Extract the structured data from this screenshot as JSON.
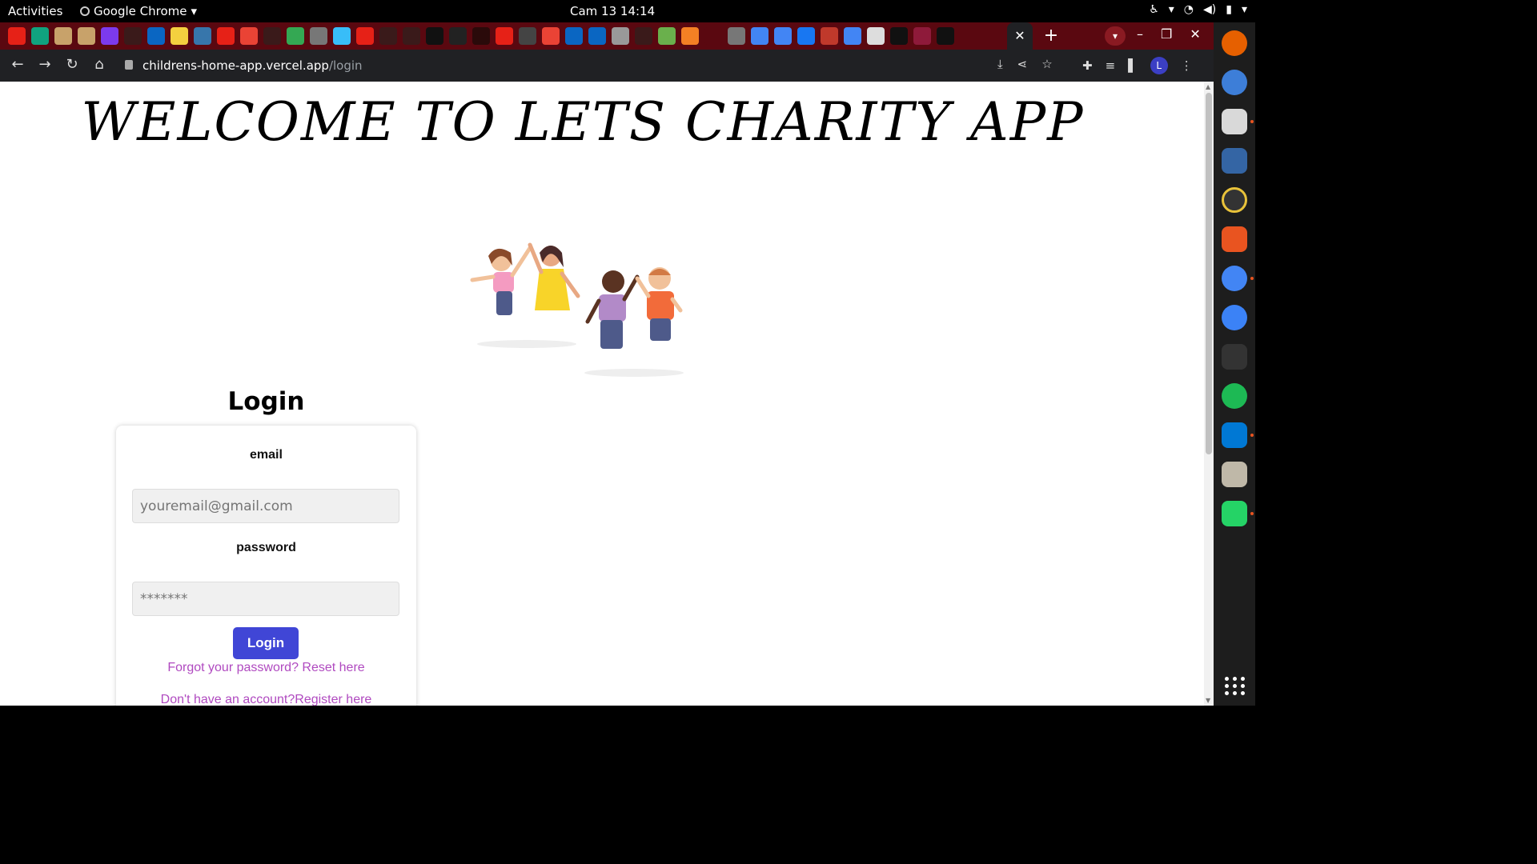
{
  "system_bar": {
    "activities": "Activities",
    "app_name": "Google Chrome",
    "clock": "Cam 13  14:14"
  },
  "browser": {
    "url_host": "childrens-home-app.vercel.app",
    "url_path": "/login",
    "profile_initial": "L"
  },
  "page": {
    "welcome_title": "WELCOME TO LETS CHARITY APP",
    "login_heading": "Login",
    "email_label": "email",
    "email_placeholder": "youremail@gmail.com",
    "password_label": "password",
    "password_placeholder": "*******",
    "login_button": "Login",
    "forgot_link": "Forgot your password? Reset here",
    "register_link": "Don't have an account?Register here"
  },
  "colors": {
    "tabstrip": "#5a0810",
    "login_button": "#4046d6",
    "link": "#b04ac0"
  }
}
